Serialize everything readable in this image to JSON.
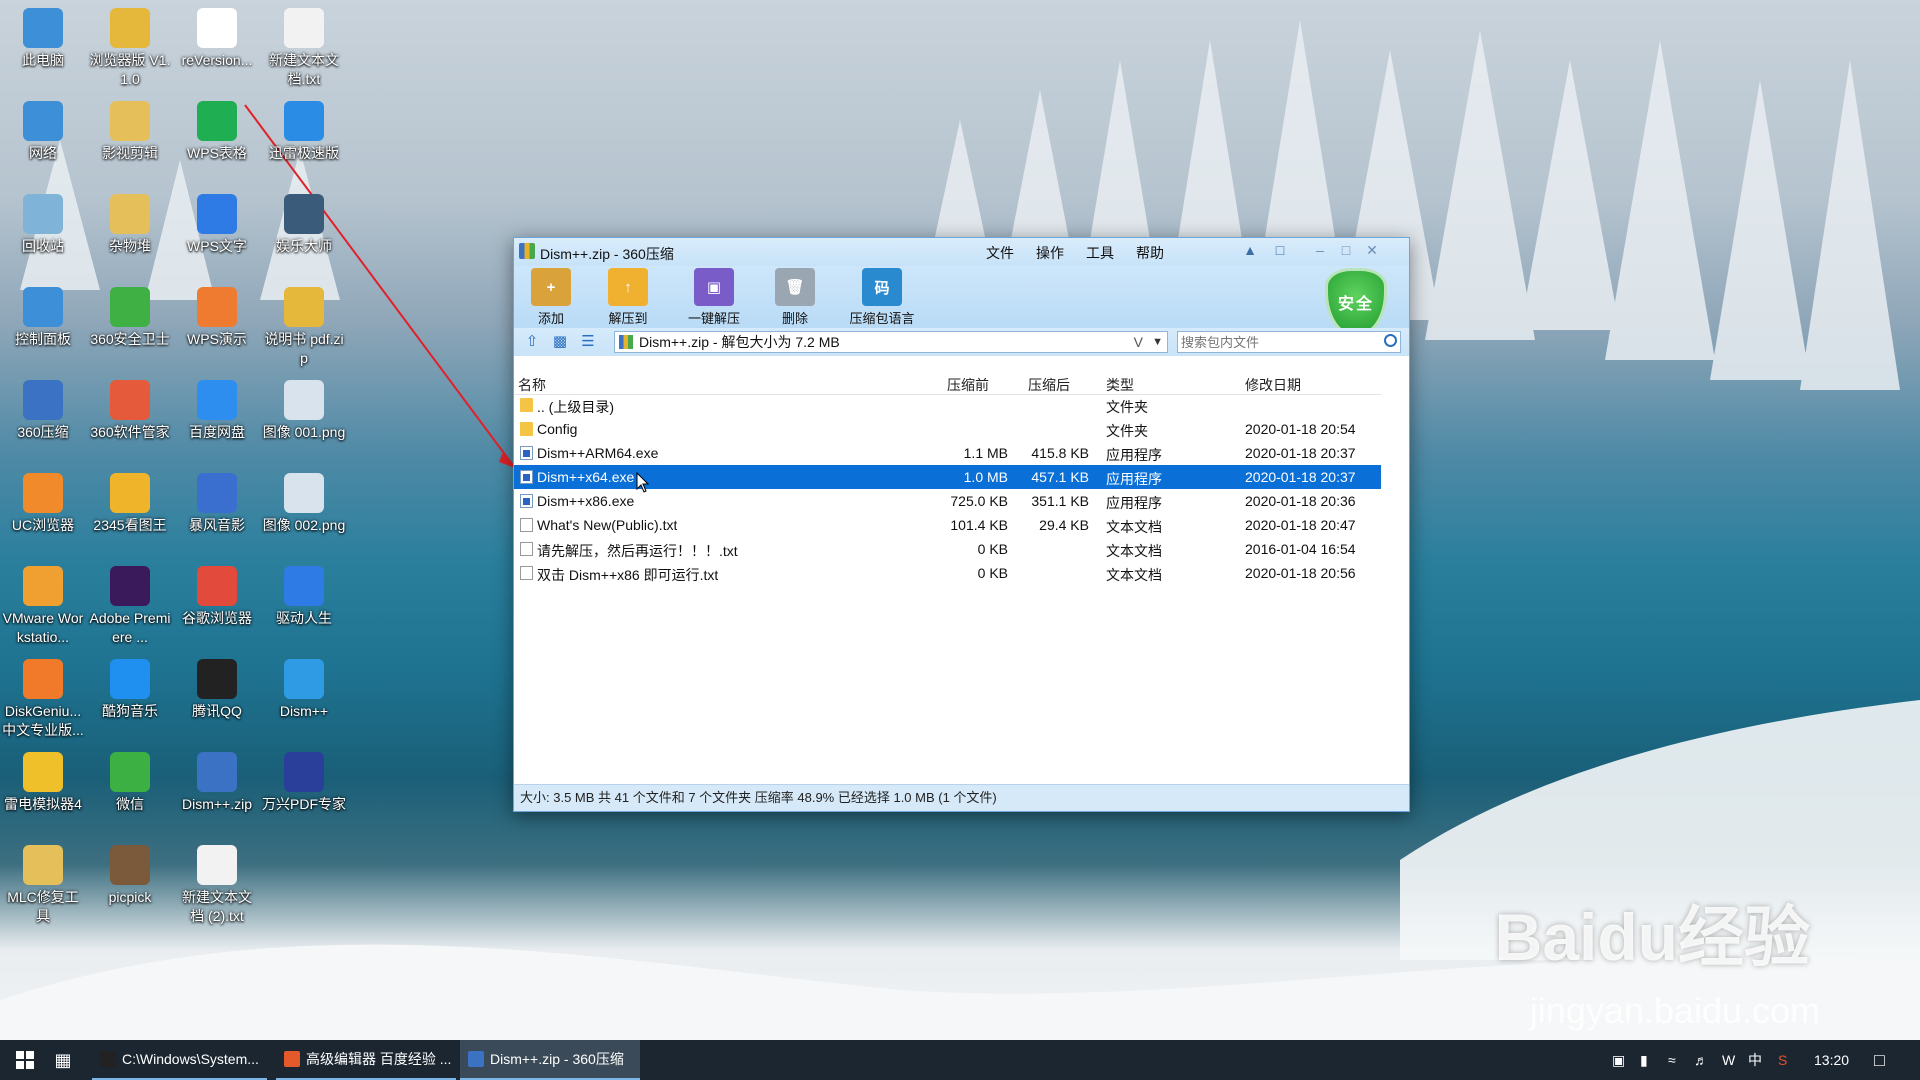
{
  "desktop": {
    "icons": [
      {
        "label": "此电脑",
        "color": "#3d8fd8"
      },
      {
        "label": "浏览器版 V1.1.0",
        "color": "#e5b73b"
      },
      {
        "label": "reVersion...",
        "color": "#ffffff"
      },
      {
        "label": "新建文本文 档.txt",
        "color": "#f2f2f2"
      },
      {
        "label": "网络",
        "color": "#3d8fd8"
      },
      {
        "label": "影视剪辑",
        "color": "#e5c05a"
      },
      {
        "label": "WPS表格",
        "color": "#1fae52"
      },
      {
        "label": "迅雷极速版",
        "color": "#2b8ce6"
      },
      {
        "label": "回收站",
        "color": "#7fb3d8"
      },
      {
        "label": "杂物堆",
        "color": "#e5c05a"
      },
      {
        "label": "WPS文字",
        "color": "#2f7be5"
      },
      {
        "label": "娱乐大师",
        "color": "#3b5b7a"
      },
      {
        "label": "控制面板",
        "color": "#3d8fd8"
      },
      {
        "label": "360安全卫士",
        "color": "#3fb043"
      },
      {
        "label": "WPS演示",
        "color": "#ee7b2f"
      },
      {
        "label": "说明书 pdf.zip",
        "color": "#e5b73b"
      },
      {
        "label": "360压缩",
        "color": "#3b72c4"
      },
      {
        "label": "360软件管家",
        "color": "#e55a3b"
      },
      {
        "label": "百度网盘",
        "color": "#2e8ef0"
      },
      {
        "label": "图像 001.png",
        "color": "#d8e3ee"
      },
      {
        "label": "UC浏览器",
        "color": "#f08a2a"
      },
      {
        "label": "2345看图王",
        "color": "#f0b42a"
      },
      {
        "label": "暴风音影",
        "color": "#3a6fd0"
      },
      {
        "label": "图像 002.png",
        "color": "#d8e3ee"
      },
      {
        "label": "VMware Workstatio...",
        "color": "#f0a030"
      },
      {
        "label": "Adobe Premiere ...",
        "color": "#3b1a5c"
      },
      {
        "label": "谷歌浏览器",
        "color": "#e24a3b"
      },
      {
        "label": "驱动人生",
        "color": "#2f7be5"
      },
      {
        "label": "DiskGeniu... 中文专业版...",
        "color": "#f07a2a"
      },
      {
        "label": "酷狗音乐",
        "color": "#1f8ff0"
      },
      {
        "label": "腾讯QQ",
        "color": "#222222"
      },
      {
        "label": "Dism++",
        "color": "#2f9be5"
      },
      {
        "label": "雷电模拟器4",
        "color": "#f0c02a"
      },
      {
        "label": "微信",
        "color": "#3cb043"
      },
      {
        "label": "Dism++.zip",
        "color": "#3b72c4"
      },
      {
        "label": "万兴PDF专家",
        "color": "#2a3f9a"
      },
      {
        "label": "MLC修复工 具",
        "color": "#e5c05a"
      },
      {
        "label": "picpick",
        "color": "#7a5a3b"
      },
      {
        "label": "新建文本文 档 (2).txt",
        "color": "#f2f2f2"
      }
    ]
  },
  "window": {
    "title": "Dism++.zip - 360压缩",
    "menus": [
      "文件",
      "操作",
      "工具",
      "帮助"
    ],
    "tools": [
      {
        "label": "添加",
        "icon": "add-archive-icon",
        "color": "#d9a23a"
      },
      {
        "label": "解压到",
        "icon": "extract-to-icon",
        "color": "#f0b030"
      },
      {
        "label": "一键解压",
        "icon": "one-click-extract-icon",
        "color": "#7a5cc8"
      },
      {
        "label": "删除",
        "icon": "trash-icon",
        "color": "#9aa6b2"
      },
      {
        "label": "压缩包语言",
        "icon": "archive-language-icon",
        "color": "#2a8ad0"
      }
    ],
    "safe_label": "安全",
    "address": {
      "path": "Dism++.zip - 解包大小为 7.2 MB",
      "v_mark": "V",
      "search_placeholder": "搜索包内文件"
    },
    "columns": {
      "name": "名称",
      "before": "压缩前",
      "after": "压缩后",
      "type": "类型",
      "date": "修改日期"
    },
    "files": [
      {
        "name": ".. (上级目录)",
        "before": "",
        "after": "",
        "type": "文件夹",
        "date": "",
        "kind": "folder",
        "selected": false
      },
      {
        "name": "Config",
        "before": "",
        "after": "",
        "type": "文件夹",
        "date": "2020-01-18 20:54",
        "kind": "folder",
        "selected": false
      },
      {
        "name": "Dism++ARM64.exe",
        "before": "1.1 MB",
        "after": "415.8 KB",
        "type": "应用程序",
        "date": "2020-01-18 20:37",
        "kind": "exe",
        "selected": false
      },
      {
        "name": "Dism++x64.exe",
        "before": "1.0 MB",
        "after": "457.1 KB",
        "type": "应用程序",
        "date": "2020-01-18 20:37",
        "kind": "exe",
        "selected": true
      },
      {
        "name": "Dism++x86.exe",
        "before": "725.0 KB",
        "after": "351.1 KB",
        "type": "应用程序",
        "date": "2020-01-18 20:36",
        "kind": "exe",
        "selected": false
      },
      {
        "name": "What's New(Public).txt",
        "before": "101.4 KB",
        "after": "29.4 KB",
        "type": "文本文档",
        "date": "2020-01-18 20:47",
        "kind": "txt",
        "selected": false
      },
      {
        "name": "请先解压，然后再运行！！！.txt",
        "before": "0 KB",
        "after": "",
        "type": "文本文档",
        "date": "2016-01-04 16:54",
        "kind": "txt",
        "selected": false
      },
      {
        "name": "双击 Dism++x86 即可运行.txt",
        "before": "0 KB",
        "after": "",
        "type": "文本文档",
        "date": "2020-01-18 20:56",
        "kind": "txt",
        "selected": false
      }
    ],
    "status": "大小: 3.5 MB 共 41 个文件和 7 个文件夹 压缩率 48.9% 已经选择 1.0 MB (1 个文件)"
  },
  "taskbar": {
    "tasks": [
      {
        "label": "C:\\Windows\\System...",
        "color": "#222222",
        "active": false
      },
      {
        "label": "高级编辑器 百度经验 ...",
        "color": "#e55a2a",
        "active": false
      },
      {
        "label": "Dism++.zip - 360压缩",
        "color": "#3b72c4",
        "active": true
      }
    ],
    "ime": "中",
    "time": "13:20"
  },
  "watermark": {
    "brand": "Baidu经验",
    "url": "jingyan.baidu.com"
  }
}
